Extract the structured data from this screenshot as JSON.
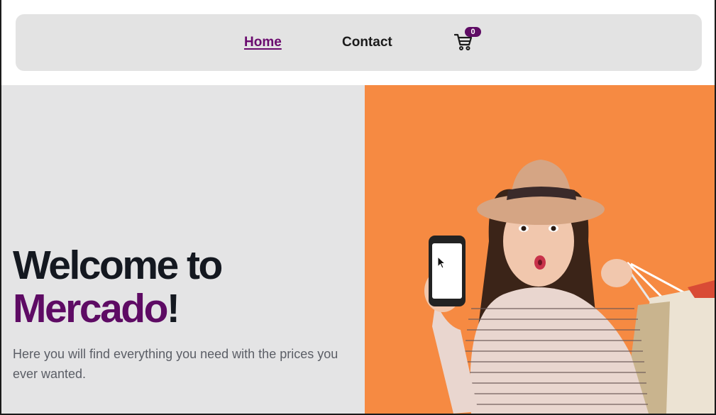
{
  "nav": {
    "home_label": "Home",
    "contact_label": "Contact",
    "cart_count": "0"
  },
  "hero": {
    "title_line1": "Welcome to",
    "brand_name": "Mercado",
    "title_suffix": "!",
    "subtitle": "Here you will find everything you need with the prices you ever wanted."
  },
  "colors": {
    "brand_purple": "#5e0b64",
    "hero_orange": "#f68a42",
    "nav_bg": "#e3e3e3",
    "hero_left_bg": "#e4e4e5"
  },
  "icons": {
    "cart": "shopping-cart-icon"
  }
}
